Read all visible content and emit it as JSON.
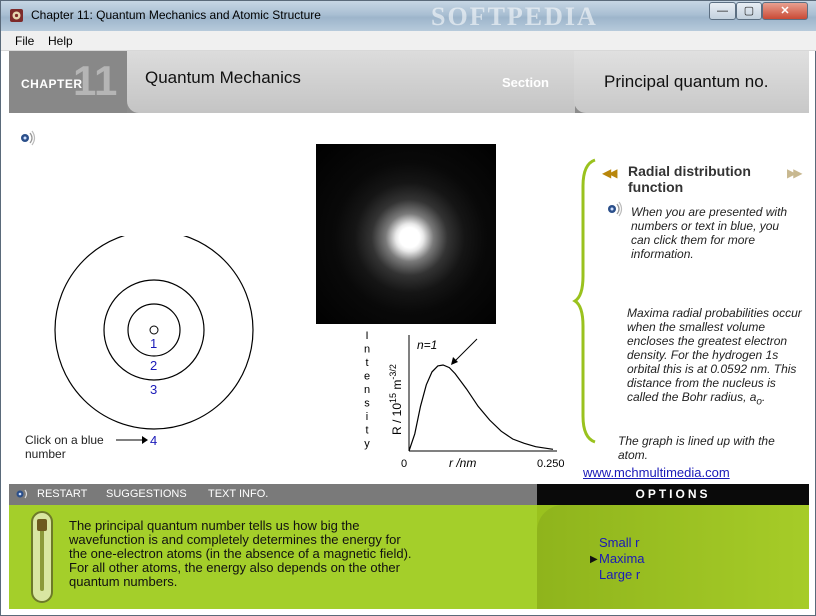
{
  "window": {
    "title": "Chapter 11:  Quantum Mechanics and Atomic Structure",
    "watermark": "SOFTPEDIA",
    "controls": {
      "minimize": "—",
      "maximize": "▢",
      "close": "✕"
    }
  },
  "menu": [
    "File",
    "Help"
  ],
  "header": {
    "chapter_word": "CHAPTER",
    "chapter_number": "11",
    "topic": "Quantum Mechanics",
    "section_word": "Section",
    "subtopic": "Principal quantum no."
  },
  "diagram": {
    "orbit_labels": [
      "1",
      "2",
      "3",
      "4"
    ],
    "click_hint": "Click on a blue number"
  },
  "chart_data": {
    "type": "line",
    "title": "",
    "xlabel": "r /nm",
    "ylabel": "Intensity",
    "ylabel_axis": "R / 10^15 m^-3/2",
    "ylabel_parts": [
      "R / 10",
      "15",
      " m",
      "-3/2"
    ],
    "xticks": [
      "0",
      "0.250"
    ],
    "xlim": [
      0,
      0.25
    ],
    "annotation": "n=1",
    "series": [
      {
        "x": [
          0,
          0.01,
          0.02,
          0.03,
          0.04,
          0.05,
          0.0592,
          0.07,
          0.08,
          0.1,
          0.12,
          0.14,
          0.16,
          0.18,
          0.2,
          0.22,
          0.25
        ],
        "y": [
          0,
          0.2,
          0.52,
          0.77,
          0.92,
          0.99,
          1.0,
          0.97,
          0.9,
          0.72,
          0.52,
          0.36,
          0.23,
          0.14,
          0.09,
          0.05,
          0.02
        ]
      }
    ]
  },
  "info": {
    "heading": "Radial distribution function",
    "hint": "When you are presented with numbers or text in blue, you can click them for more information.",
    "body": "Maxima radial probabilities occur when the smallest volume encloses the greatest electron density. For the hydrogen 1s orbital this is at 0.0592 nm. This distance from the nucleus is called the Bohr radius, a",
    "body_subscript": "o",
    "body_end": ".",
    "graph_note": "The graph is lined up with the atom.",
    "website": "www.mchmultimedia.com"
  },
  "toolbar": {
    "restart": "RESTART",
    "suggestions": "SUGGESTIONS",
    "text_info": "TEXT INFO."
  },
  "options": {
    "heading": "OPTIONS",
    "items": [
      "Small r",
      "Maxima",
      "Large r"
    ],
    "selected": "Maxima"
  },
  "description": "The principal quantum number tells us how big the wavefunction is and completely determines the energy for the one-electron atoms (in the absence of a magnetic field).  For all other atoms, the energy also depends on the other quantum numbers.",
  "colors": {
    "link_blue": "#1a1ab8",
    "panel_green": "#a4cf2a",
    "header_gray": "#8c8c8c"
  }
}
